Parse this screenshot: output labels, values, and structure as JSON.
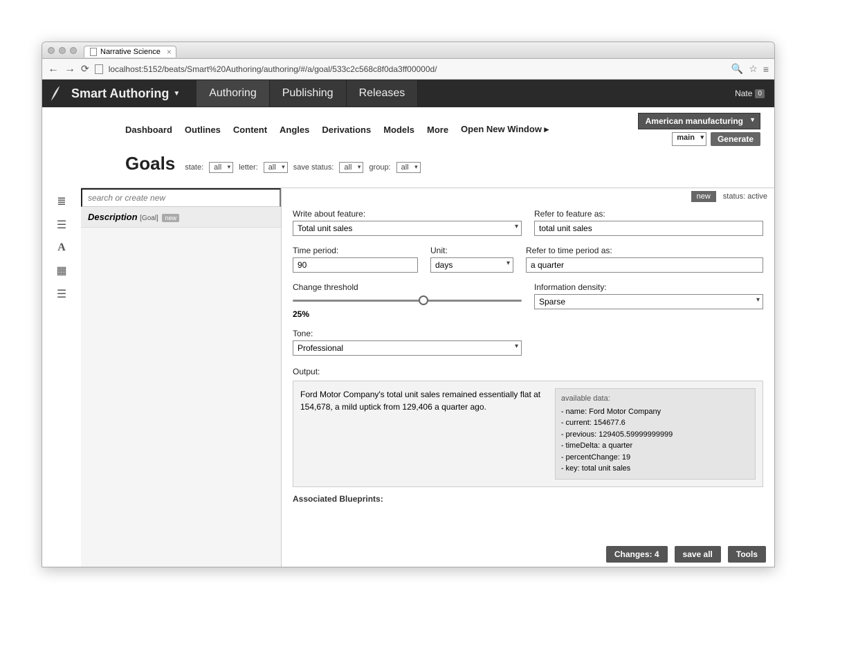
{
  "browser": {
    "tab_title": "Narrative Science",
    "url": "localhost:5152/beats/Smart%20Authoring/authoring/#/a/goal/533c2c568c8f0da3ff00000d/"
  },
  "header": {
    "brand": "Smart Authoring",
    "nav": [
      "Authoring",
      "Publishing",
      "Releases"
    ],
    "user_name": "Nate",
    "user_badge": "0"
  },
  "subnav": {
    "items": [
      "Dashboard",
      "Outlines",
      "Content",
      "Angles",
      "Derivations",
      "Models",
      "More",
      "Open New Window"
    ],
    "project": "American manufacturing",
    "branch": "main",
    "generate": "Generate"
  },
  "filters": {
    "title": "Goals",
    "state_label": "state:",
    "state_val": "all",
    "letter_label": "letter:",
    "letter_val": "all",
    "save_label": "save status:",
    "save_val": "all",
    "group_label": "group:",
    "group_val": "all"
  },
  "list": {
    "search_placeholder": "search or create new",
    "item_title": "Description",
    "item_tag": "[Goal]",
    "item_new": "new"
  },
  "editor_top": {
    "new": "new",
    "status_label": "status:",
    "status_value": "active"
  },
  "form": {
    "feature_label": "Write about feature:",
    "feature_value": "Total unit sales",
    "refer_feature_label": "Refer to feature as:",
    "refer_feature_value": "total unit sales",
    "time_label": "Time period:",
    "time_value": "90",
    "unit_label": "Unit:",
    "unit_value": "days",
    "refer_time_label": "Refer to time period as:",
    "refer_time_value": "a quarter",
    "threshold_label": "Change threshold",
    "threshold_value": "25%",
    "density_label": "Information density:",
    "density_value": "Sparse",
    "tone_label": "Tone:",
    "tone_value": "Professional",
    "output_label": "Output:",
    "output_text": "Ford Motor Company's total unit sales remained essentially flat at 154,678, a mild uptick from 129,406 a quarter ago.",
    "avail_header": "available data:",
    "avail_lines": {
      "l0": "- name: Ford Motor Company",
      "l1": "- current: 154677.6",
      "l2": "- previous: 129405.59999999999",
      "l3": "- timeDelta: a quarter",
      "l4": "- percentChange: 19",
      "l5": "- key: total unit sales"
    },
    "assoc_label": "Associated Blueprints:"
  },
  "footer": {
    "changes": "Changes: 4",
    "save": "save all",
    "tools": "Tools"
  }
}
